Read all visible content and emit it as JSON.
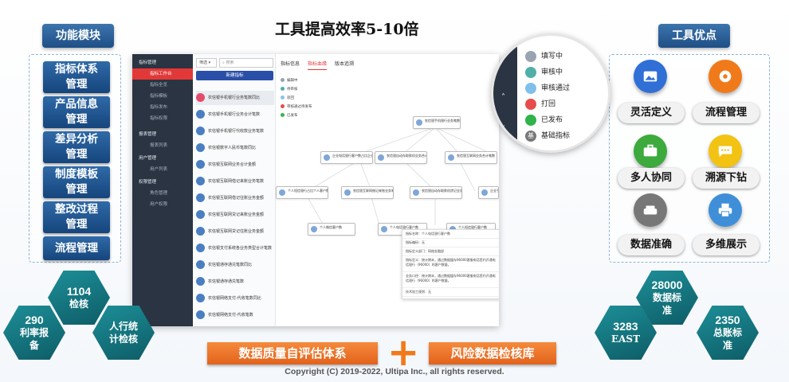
{
  "header": {
    "title": "工具提高效率5-10倍"
  },
  "left": {
    "tag": "功能模块",
    "modules": [
      {
        "line1": "指标体系",
        "line2": "管理"
      },
      {
        "line1": "产品信息",
        "line2": "管理"
      },
      {
        "line1": "差异分析",
        "line2": "管理"
      },
      {
        "line1": "制度模板",
        "line2": "管理"
      },
      {
        "line1": "整改过程",
        "line2": "管理"
      },
      {
        "line1": "流程管理",
        "line2": ""
      }
    ]
  },
  "right": {
    "tag": "工具优点",
    "advantages": [
      {
        "label": "灵活定义",
        "icon": "image-icon",
        "color": "#2f6fd6"
      },
      {
        "label": "流程管理",
        "icon": "disc-icon",
        "color": "#f07a1a"
      },
      {
        "label": "多人协同",
        "icon": "briefcase-icon",
        "color": "#3caa3c"
      },
      {
        "label": "溯源下钻",
        "icon": "chat-icon",
        "color": "#f2c312"
      },
      {
        "label": "数据准确",
        "icon": "sofa-icon",
        "color": "#777777"
      },
      {
        "label": "多维展示",
        "icon": "printer-icon",
        "color": "#3f8fd8"
      }
    ]
  },
  "app": {
    "sidebar": [
      {
        "label": "指标管理",
        "type": "head"
      },
      {
        "label": "指标工作台",
        "type": "active"
      },
      {
        "label": "指标全览",
        "type": "sub"
      },
      {
        "label": "指标模板",
        "type": "sub"
      },
      {
        "label": "指标发布",
        "type": "sub"
      },
      {
        "label": "指标权限",
        "type": "sub"
      },
      {
        "label": "报表管理",
        "type": "head"
      },
      {
        "label": "报表列表",
        "type": "sub"
      },
      {
        "label": "用户管理",
        "type": "head"
      },
      {
        "label": "用户列表",
        "type": "sub"
      },
      {
        "label": "权限管理",
        "type": "head"
      },
      {
        "label": "角色管理",
        "type": "sub"
      },
      {
        "label": "用户权限",
        "type": "sub"
      }
    ],
    "filter": {
      "select": "筛选",
      "placeholder": "搜索"
    },
    "new_button": "新建指标",
    "list_items": [
      "农信银手机银行业务笔数同比",
      "农信银手机银行业务合计笔数",
      "农信银手机银行代收款业务笔数",
      "农信银数字人民币笔数同比",
      "农信银互联网业务合计金额",
      "农信银互联网借记来账业务笔数",
      "农信银互联网借记往账业务金额",
      "农信银互联网贷记来账业务金额",
      "农信银互联网贷记往账业务金额",
      "农信银支付系统各业务类型合计笔数",
      "农信银通存通兑笔数同比",
      "农信银通存通兑笔数",
      "农信银网络支付-代收笔数同比",
      "农信银网络支付-代收笔数"
    ],
    "tabs": [
      "指标信息",
      "指标血缘",
      "版本追溯"
    ],
    "legend": [
      "编辑中",
      "待审核",
      "驳回",
      "审核通过待发布",
      "已发布"
    ],
    "legend_colors": [
      "#9aa4b0",
      "#4fb0a8",
      "#8cc0e8",
      "#e84b4b",
      "#3ab54a"
    ],
    "nodes": [
      "农信银手机银行业务笔数同比",
      "企业电话银行客户数占比企业客户数",
      "农信银自动存取款机业务合计笔数",
      "农信银互联网业务合计笔数",
      "SEO分类企业网银贷款余额（不...",
      "个人短信银行占比个人客户数",
      "农信银互联网借记来账业务笔数",
      "农信银自动存取款机贷记业务笔数",
      "企业手机银行贷款客户数",
      "企业电话银行客户数",
      "个人微信客户数",
      "个人电话银行客户数",
      "个人短信银行客户数"
    ],
    "info_rows": [
      "指标名称：个人电话银行客户数",
      "指标编码：无",
      "指标定义部门：网络金融部",
      "指标定义：统计期末，通过数据缓存96000客服电话签约开通电话银行（96000）的客户数量。",
      "业务口径：统计期末，通过数据缓存96000客服电话签约开通电话银行（96000）的客户数量。",
      "技术加工规则：无"
    ]
  },
  "zoom_legend": [
    {
      "label": "填写中",
      "color": "#9aa4b0"
    },
    {
      "label": "审核中",
      "color": "#4fb0a8"
    },
    {
      "label": "审核通过",
      "color": "#7fc0ea"
    },
    {
      "label": "打回",
      "color": "#e84b4b"
    },
    {
      "label": "已发布",
      "color": "#2fb34a"
    },
    {
      "label": "基础指标",
      "color": "#777777",
      "glyph": "基"
    }
  ],
  "stats": {
    "left": [
      {
        "num": "1104",
        "text": "检核"
      },
      {
        "num": "290",
        "text": "利率报备"
      },
      {
        "num": "",
        "text": "人行统计检核"
      }
    ],
    "right": [
      {
        "num": "28000",
        "text": "数据标准"
      },
      {
        "num": "2350",
        "text": "总账标准"
      },
      {
        "num": "3283",
        "text": "EAST"
      }
    ]
  },
  "footer": {
    "banner_left": "数据质量自评估体系",
    "plus": "+",
    "banner_right": "风险数据检核库",
    "copyright": "Copyright (C) 2019-2022, Ultipa Inc., all rights reserved."
  }
}
